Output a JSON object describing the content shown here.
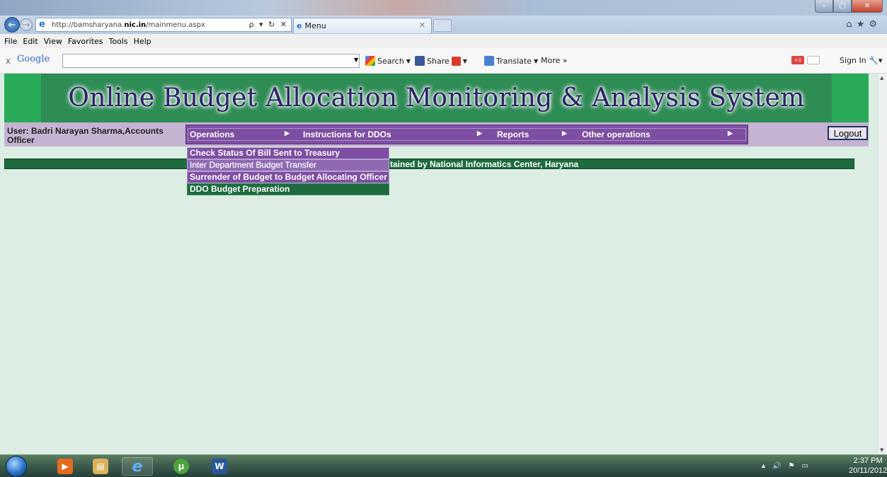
{
  "browser": {
    "url_prefix": "http://bamsharyana.",
    "url_domain": "nic.in",
    "url_suffix": "/mainmenu.aspx",
    "address_tools": "ρ ▾ ↻ ✕",
    "tab_title": "Menu",
    "window_controls": {
      "minimize": "–",
      "maximize": "□",
      "close": "✕"
    },
    "menu": [
      "File",
      "Edit",
      "View",
      "Favorites",
      "Tools",
      "Help"
    ]
  },
  "google_toolbar": {
    "close_label": "x",
    "logo": "Google",
    "search_label": "Search",
    "share_label": "Share",
    "translate_label": "Translate",
    "more_label": "More »",
    "plusone_label": "+1",
    "signin_label": "Sign In"
  },
  "page": {
    "banner_title": "Online Budget Allocation Monitoring & Analysis System",
    "user_line1": "User: Badri Narayan Sharma,Accounts",
    "user_line2": "Officer",
    "nav": [
      {
        "label": "Operations"
      },
      {
        "label": "Instructions for DDOs"
      },
      {
        "label": "Reports"
      },
      {
        "label": "Other operations"
      }
    ],
    "logout_label": "Logout",
    "footer_text": "tained by National Informatics Center, Haryana",
    "dropdown": [
      {
        "label": "Check Status Of Bill Sent to Treasury"
      },
      {
        "label": "Inter Department Budget Transfer"
      },
      {
        "label": "Surrender of Budget to Budget Allocating Officer"
      },
      {
        "label": "DDO Budget Preparation"
      }
    ]
  },
  "taskbar": {
    "time": "2:37 PM",
    "date": "20/11/2012"
  },
  "colors": {
    "banner_green": "#2e8c55",
    "nav_purple": "#7d4ea1",
    "user_bar": "#c5b3d2",
    "footer_green": "#1d6b3e",
    "page_bg": "#dcede3"
  }
}
